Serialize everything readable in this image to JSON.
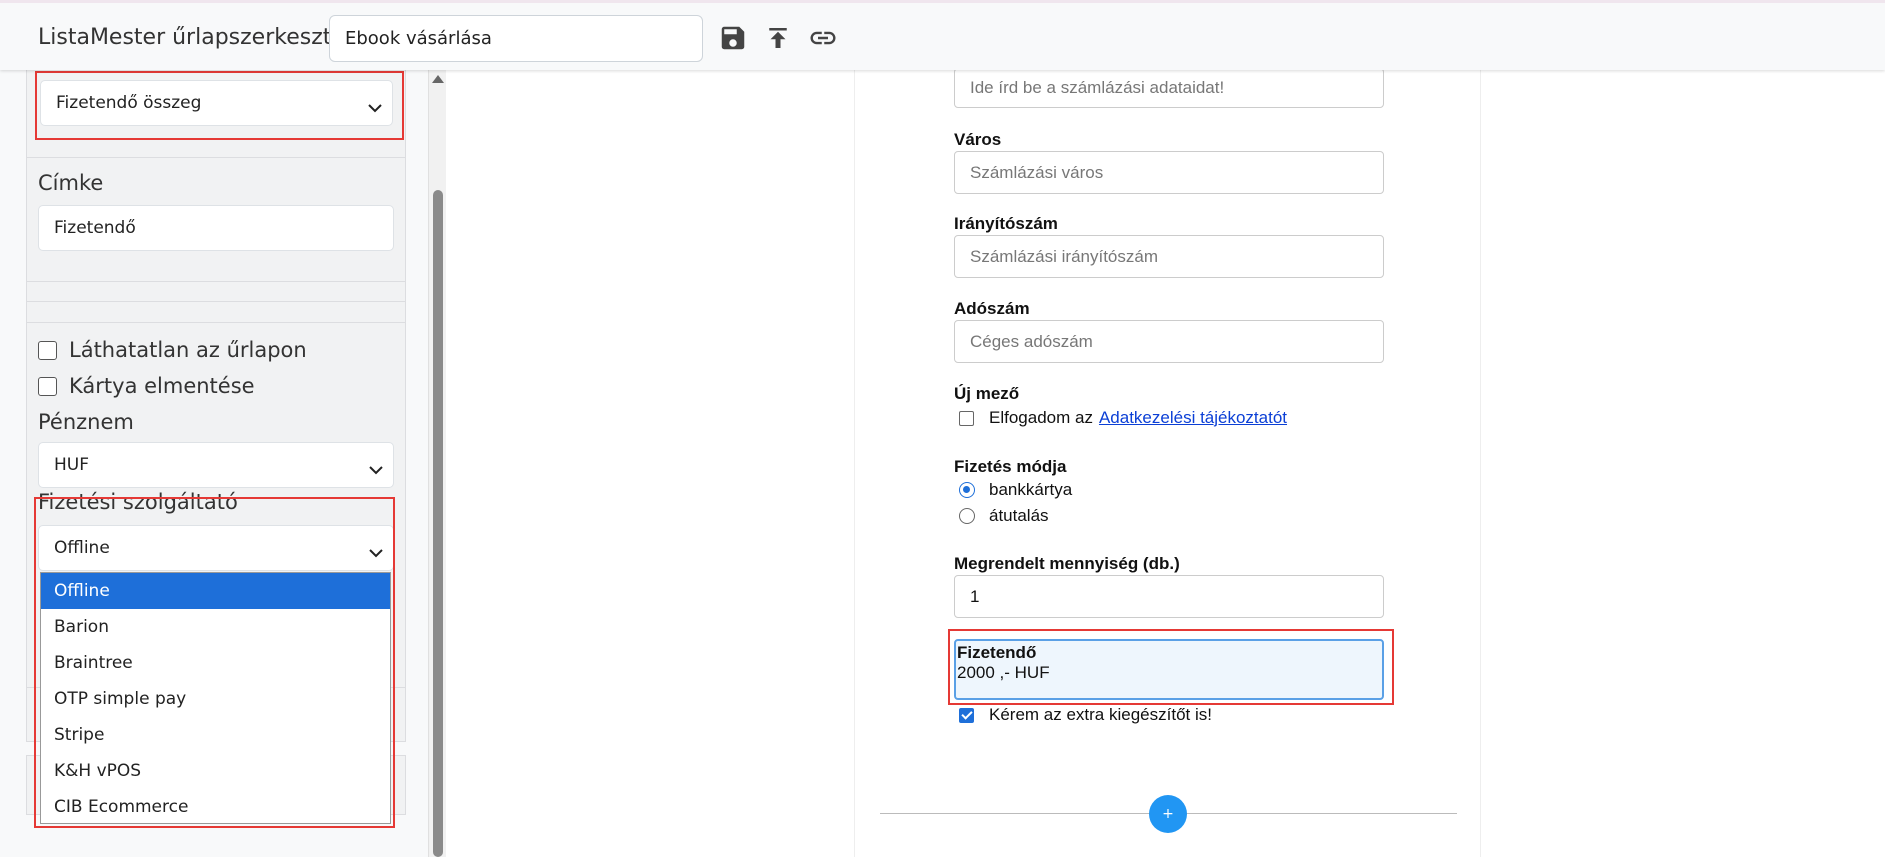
{
  "header": {
    "app_title": "ListaMester űrlapszerkesztő:",
    "form_name": "Ebook vásárlása",
    "icons": [
      "save-icon",
      "upload-icon",
      "link-icon"
    ]
  },
  "left_panel": {
    "field_type_select": "Fizetendő összeg",
    "label_section": {
      "title": "Címke",
      "value": "Fizetendő"
    },
    "options": {
      "invisible_label": "Láthatatlan az űrlapon",
      "save_card_label": "Kártya elmentése",
      "currency_label": "Pénznem",
      "currency_value": "HUF",
      "provider_label": "Fizetési szolgáltató",
      "provider_value": "Offline",
      "provider_options": [
        "Offline",
        "Barion",
        "Braintree",
        "OTP simple pay",
        "Stripe",
        "K&H vPOS",
        "CIB Ecommerce"
      ]
    }
  },
  "form": {
    "billing_placeholder": "Ide írd be a számlázási adataidat!",
    "city": {
      "label": "Város",
      "placeholder": "Számlázási város"
    },
    "zip": {
      "label": "Irányítószám",
      "placeholder": "Számlázási irányítószám"
    },
    "tax": {
      "label": "Adószám",
      "placeholder": "Céges adószám"
    },
    "new_field": {
      "label": "Új mező",
      "text": "Elfogadom az",
      "link": "Adatkezelési tájékoztatót"
    },
    "payment_method": {
      "label": "Fizetés módja",
      "options": [
        "bankkártya",
        "átutalás"
      ],
      "selected": "bankkártya"
    },
    "quantity": {
      "label": "Megrendelt mennyiség (db.)",
      "value": "1"
    },
    "payable": {
      "label": "Fizetendő",
      "value": "2000 ,- HUF"
    },
    "extra": {
      "label": "Kérem az extra kiegészítőt is!",
      "checked": true
    },
    "add_button": "+"
  },
  "colors": {
    "highlight": "#e53935",
    "accent": "#1e6fd9",
    "add_button": "#2196f3"
  }
}
